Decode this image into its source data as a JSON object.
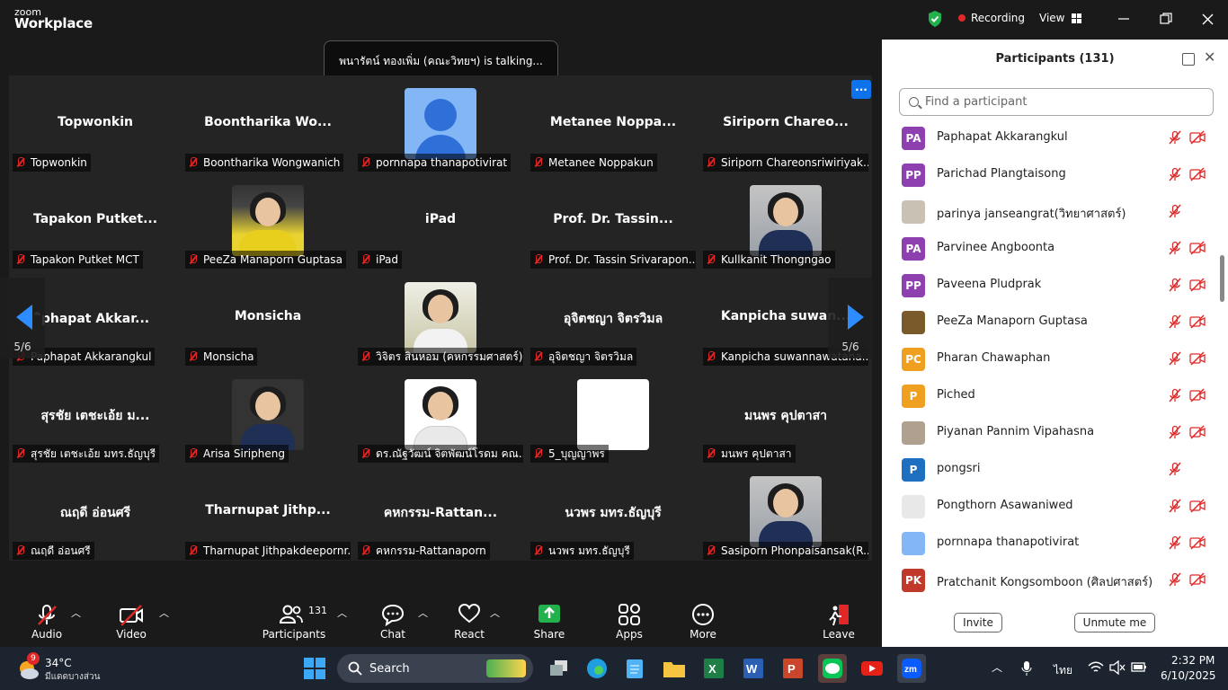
{
  "app": {
    "brand_top": "zoom",
    "brand_bottom": "Workplace",
    "recording": "Recording",
    "view": "View"
  },
  "toast": "พนารัตน์ ทองเพิ่ม (คณะวิทยฯ) is talking...",
  "gallery": {
    "page": "5/6",
    "tiles": [
      {
        "name": "Topwonkin",
        "label": "Topwonkin",
        "photo": ""
      },
      {
        "name": "Boontharika  Wo...",
        "label": "Boontharika Wongwanich",
        "photo": ""
      },
      {
        "name": "",
        "label": "pornnapa thanapotivirat",
        "photo": "default-avatar"
      },
      {
        "name": "Metanee  Noppa...",
        "label": "Metanee Noppakun",
        "photo": ""
      },
      {
        "name": "Siriporn  Chareo...",
        "label": "Siriporn Chareonsriwiriyak...",
        "photo": ""
      },
      {
        "name": "Tapakon  Putket...",
        "label": "Tapakon Putket MCT",
        "photo": ""
      },
      {
        "name": "",
        "label": "PeeZa Manaporn Guptasa",
        "photo": "yellow"
      },
      {
        "name": "iPad",
        "label": "iPad",
        "photo": ""
      },
      {
        "name": "Prof. Dr. Tassin...",
        "label": "Prof. Dr. Tassin Srivarapon...",
        "photo": ""
      },
      {
        "name": "",
        "label": "Kullkanit Thongngao",
        "photo": "suit"
      },
      {
        "name": "ิphapat  Akkar...",
        "label": "Paphapat Akkarangkul",
        "photo": ""
      },
      {
        "name": "Monsicha",
        "label": "Monsicha",
        "photo": ""
      },
      {
        "name": "",
        "label": "วิจิตร  สินหอม (คหกรรมศาสตร์)",
        "photo": "lab"
      },
      {
        "name": "อุจิตชญา จิตรวิมล",
        "label": "อุจิตชญา จิตรวิมล",
        "photo": ""
      },
      {
        "name": "Kanpicha  suwan...",
        "label": "Kanpicha suwannawatana...",
        "photo": ""
      },
      {
        "name": "สุรชัย เตชะเอ้ย ม...",
        "label": "สุรชัย เตชะเอ้ย มทร.ธัญบุรี",
        "photo": ""
      },
      {
        "name": "",
        "label": "Arisa Siripheng",
        "photo": "suit-woman"
      },
      {
        "name": "",
        "label": "ดร.ณัฐวัฒน์ จิตพัฒน์โรดม คณ...",
        "photo": "uniform"
      },
      {
        "name": "",
        "label": "5_บุญญาพร",
        "photo": "blank"
      },
      {
        "name": "มนพร คุปตาสา",
        "label": "มนพร คุปตาสา",
        "photo": ""
      },
      {
        "name": "ณฤดี อ่อนศรี",
        "label": "ณฤดี อ่อนศรี",
        "photo": ""
      },
      {
        "name": "Tharnupat  Jithp...",
        "label": "Tharnupat Jithpakdeepornr...",
        "photo": ""
      },
      {
        "name": "คหกรรม-Rattan...",
        "label": "คหกรรม-Rattanaporn",
        "photo": ""
      },
      {
        "name": "นวพร มทร.ธัญบุรี",
        "label": "นวพร มทร.ธัญบุรี",
        "photo": ""
      },
      {
        "name": "",
        "label": "Sasiporn Phonpaisansak(R...",
        "photo": "suit-woman2"
      }
    ]
  },
  "toolbar": {
    "audio": "Audio",
    "video": "Video",
    "participants": "Participants",
    "participants_count": "131",
    "chat": "Chat",
    "react": "React",
    "share": "Share",
    "apps": "Apps",
    "more": "More",
    "leave": "Leave"
  },
  "panel": {
    "title": "Participants (131)",
    "search_placeholder": "Find a participant",
    "invite": "Invite",
    "unmute_me": "Unmute me",
    "participants": [
      {
        "initials": "PA",
        "name": "Paphapat Akkarangkul",
        "color": "#8e3fb0",
        "camera": true
      },
      {
        "initials": "PP",
        "name": "Parichad Plangtaisong",
        "color": "#8e3fb0",
        "camera": true
      },
      {
        "initials": "",
        "name": "parinya janseangrat(วิทยาศาสตร์)",
        "color": "#c9c1b3",
        "camera": false
      },
      {
        "initials": "PA",
        "name": "Parvinee Angboonta",
        "color": "#8e3fb0",
        "camera": true
      },
      {
        "initials": "PP",
        "name": "Paveena  Pludprak",
        "color": "#8e3fb0",
        "camera": true
      },
      {
        "initials": "",
        "name": "PeeZa Manaporn Guptasa",
        "color": "#7a5a2a",
        "camera": true
      },
      {
        "initials": "PC",
        "name": "Pharan Chawaphan",
        "color": "#f0a020",
        "camera": true
      },
      {
        "initials": "P",
        "name": "Piched",
        "color": "#f0a020",
        "camera": true
      },
      {
        "initials": "",
        "name": "Piyanan Pannim Vipahasna",
        "color": "#b0a090",
        "camera": true
      },
      {
        "initials": "P",
        "name": "pongsri",
        "color": "#1e6fc0",
        "camera": false
      },
      {
        "initials": "",
        "name": "Pongthorn Asawaniwed",
        "color": "#e8e8e8",
        "camera": true
      },
      {
        "initials": "",
        "name": "pornnapa thanapotivirat",
        "color": "#82b6f5",
        "camera": true
      },
      {
        "initials": "PK",
        "name": "Pratchanit Kongsomboon (ศิลปศาสตร์)",
        "color": "#c0392b",
        "camera": true
      }
    ]
  },
  "taskbar": {
    "weather_temp": "34°C",
    "weather_desc": "มีแดดบางส่วน",
    "weather_badge": "9",
    "search": "Search",
    "lang": "ไทย",
    "time": "2:32 PM",
    "date": "6/10/2025"
  }
}
